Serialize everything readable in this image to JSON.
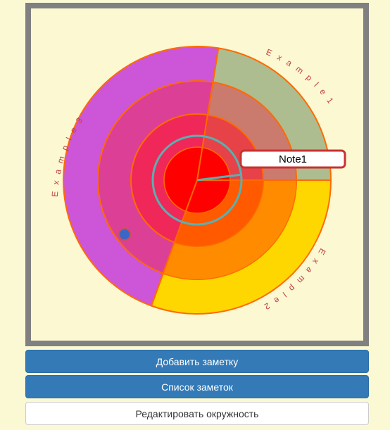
{
  "circle": {
    "sector_labels": [
      "Example1",
      "Example2",
      "Example3"
    ],
    "note_label": "Note1"
  },
  "buttons": {
    "add_note": "Добавить заметку",
    "note_list": "Список заметок",
    "edit_circle": "Редактировать окружность"
  },
  "colors": {
    "sector_1": "#adbd8f",
    "sector_2": "#ffd700",
    "sector_3": "#cc55d8",
    "ring_stroke": "#ff6a00",
    "inner_core": "#ff0000",
    "teal_ring": "#5ab0b0",
    "note_border": "#c83232",
    "marker": "#3a66c8"
  }
}
